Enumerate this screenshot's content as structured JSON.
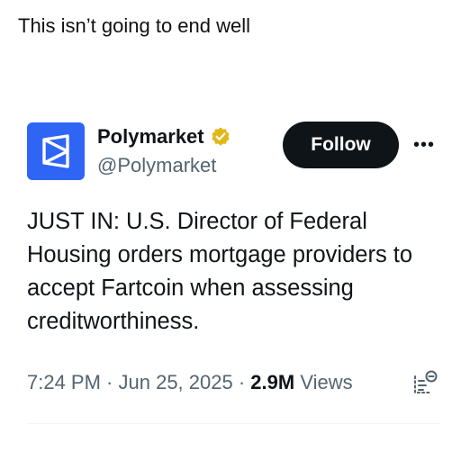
{
  "caption": "This isn’t going to end well",
  "tweet": {
    "author": {
      "name": "Polymarket",
      "handle": "@Polymarket",
      "verified": true,
      "avatar_icon": "polymarket-logo-icon",
      "avatar_color": "#2f65f5"
    },
    "follow_label": "Follow",
    "more_label": "•••",
    "text": "JUST IN: U.S. Director of Federal Housing orders mortgage providers to accept Fartcoin when assessing creditworthiness.",
    "time": "7:24 PM",
    "date": "Jun 25, 2025",
    "views_count": "2.9M",
    "views_label": "Views",
    "separator": " · "
  },
  "colors": {
    "text": "#0f1419",
    "secondary": "#536471",
    "verified_badge": "#e2b719",
    "follow_bg": "#0f1419"
  }
}
